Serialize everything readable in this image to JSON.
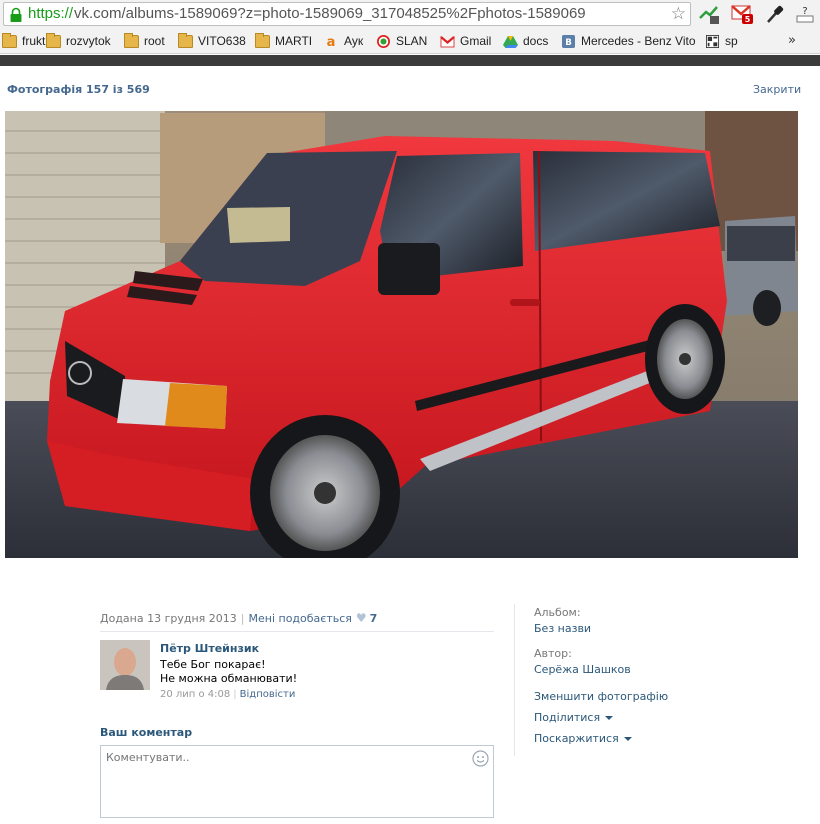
{
  "browser": {
    "url_scheme": "https://",
    "url_rest": "vk.com/albums-1589069?z=photo-1589069_317048525%2Fphotos-1589069",
    "bookmarks": [
      {
        "label": "frukt",
        "icon": "folder-icon"
      },
      {
        "label": "rozvytok",
        "icon": "folder-icon"
      },
      {
        "label": "root",
        "icon": "folder-icon"
      },
      {
        "label": "VITO638",
        "icon": "folder-icon"
      },
      {
        "label": "MARTI",
        "icon": "folder-icon"
      },
      {
        "label": "Аук",
        "icon": "amazon-icon"
      },
      {
        "label": "SLAN",
        "icon": "slan-icon"
      },
      {
        "label": "Gmail",
        "icon": "gmail-icon"
      },
      {
        "label": "docs",
        "icon": "drive-icon"
      },
      {
        "label": "Mercedes - Benz Vito",
        "icon": "vk-icon"
      },
      {
        "label": "sp",
        "icon": "grid-icon"
      }
    ],
    "bookmarks_overflow": "»",
    "gmail_badge": "5",
    "help_label": "?"
  },
  "viewer": {
    "title": "Фотографія 157 із 569",
    "close": "Закрити"
  },
  "meta": {
    "added": "Додана 13 грудня 2013",
    "like_label": "Мені подобається",
    "like_count": "7"
  },
  "comment": {
    "author": "Пётр Штейнзик",
    "text_line1": "Тебе Бог покарає!",
    "text_line2": "Не можна обманювати!",
    "date": "20 лип о 4:08",
    "reply": "Відповісти"
  },
  "your_comment": {
    "title": "Ваш коментар",
    "placeholder": "Коментувати.."
  },
  "sidebar": {
    "album_label": "Альбом:",
    "album_value": "Без назви",
    "author_label": "Автор:",
    "author_value": "Серёжа Шашков",
    "shrink": "Зменшити фотографію",
    "share": "Поділитися",
    "report": "Поскаржитися"
  },
  "colors": {
    "link": "#2b587a",
    "link_light": "#45688e",
    "url_green": "#1a9c1a",
    "van_red": "#e0242c"
  }
}
